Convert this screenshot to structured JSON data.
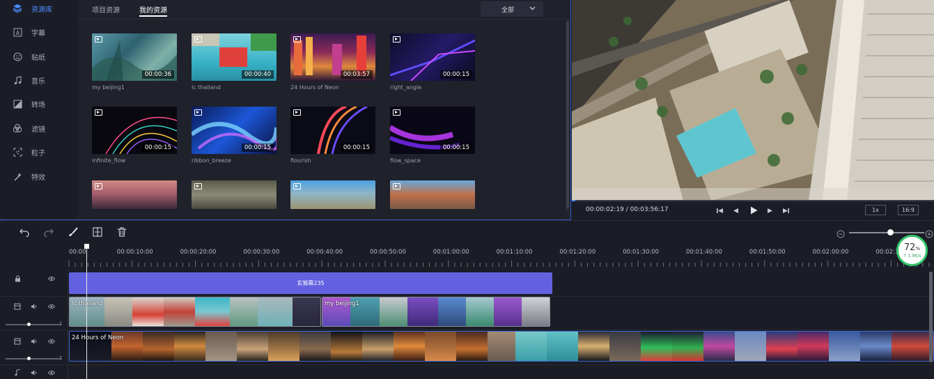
{
  "sidebar": {
    "items": [
      {
        "label": "资源库",
        "icon": "layers-icon",
        "active": true
      },
      {
        "label": "字幕",
        "icon": "text-box-icon",
        "active": false
      },
      {
        "label": "贴纸",
        "icon": "smiley-icon",
        "active": false
      },
      {
        "label": "音乐",
        "icon": "music-note-icon",
        "active": false
      },
      {
        "label": "转场",
        "icon": "transition-icon",
        "active": false
      },
      {
        "label": "滤镜",
        "icon": "filter-circles-icon",
        "active": false
      },
      {
        "label": "粒子",
        "icon": "particles-icon",
        "active": false
      },
      {
        "label": "特效",
        "icon": "magic-wand-icon",
        "active": false
      }
    ]
  },
  "tabs": {
    "project": "项目资源",
    "mine": "我的资源",
    "active": "mine"
  },
  "filter": {
    "value": "全部",
    "icon": "chevron-down-icon"
  },
  "library": {
    "cards": [
      {
        "name": "my beijing1",
        "duration": "00:00:36"
      },
      {
        "name": "lc thailand",
        "duration": "00:00:40"
      },
      {
        "name": "24 Hours of Neon",
        "duration": "00:03:57"
      },
      {
        "name": "right_angle",
        "duration": "00:00:15"
      },
      {
        "name": "infinite_flow",
        "duration": "00:00:15"
      },
      {
        "name": "ribbon_breeze",
        "duration": "00:00:15"
      },
      {
        "name": "flourish",
        "duration": "00:00:15"
      },
      {
        "name": "flow_space",
        "duration": "00:00:15"
      },
      {
        "name": "",
        "duration": ""
      },
      {
        "name": "",
        "duration": ""
      },
      {
        "name": "",
        "duration": ""
      },
      {
        "name": "",
        "duration": ""
      }
    ]
  },
  "preview": {
    "timecode": "00:00:02:19 / 00:03:56:17",
    "speed": "1x",
    "ratio": "16:9",
    "progress_fraction": 0.01
  },
  "toolbar": {
    "icons": [
      "undo-icon",
      "redo-icon",
      "brush-icon",
      "split-icon",
      "trash-icon"
    ],
    "zoom_out_icon": "zoom-out-icon",
    "zoom_in_icon": "zoom-in-icon",
    "zoom_level_fraction": 0.52
  },
  "ruler": {
    "labels": [
      "00:00",
      "00:00:10:00",
      "00:00:20:00",
      "00:00:30:00",
      "00:00:40:00",
      "00:00:50:00",
      "00:01:00:00",
      "00:01:10:00",
      "00:01:20:00",
      "00:01:30:00",
      "00:01:40:00",
      "00:01:50:00",
      "00:02:00:00",
      "00:02:10:00"
    ]
  },
  "tracks": {
    "subtitle_clip": "玄猴幕235",
    "clips_row2": [
      "lc thailand",
      "my beijing1"
    ],
    "clip_row3": "24 Hours of Neon",
    "track_value": "1"
  },
  "network": {
    "percent": "72",
    "unit": "%",
    "speed": "↑ 1.9K/s"
  },
  "colors": {
    "accent": "#4b8cff",
    "subtitle_clip": "#6262e0",
    "selection_border": "#2f58c9"
  }
}
